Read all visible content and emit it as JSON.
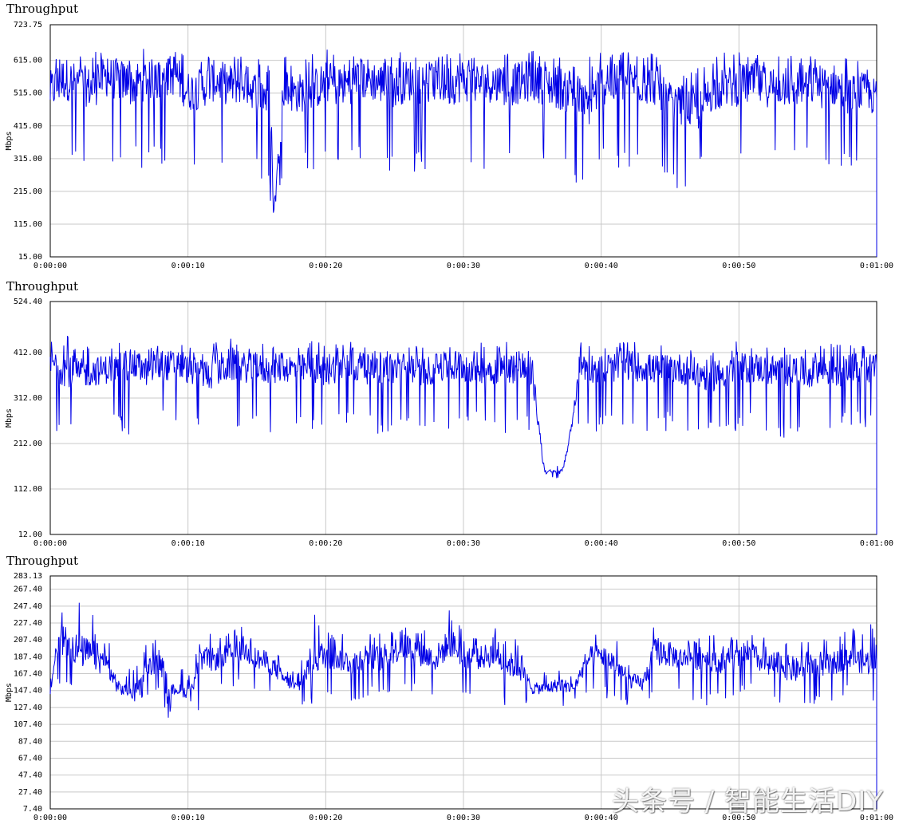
{
  "colors": {
    "series": "#0000e6",
    "grid": "#c8c8c8",
    "axis": "#000000"
  },
  "watermark": "头条号 / 智能生活DIY",
  "chart_data": [
    {
      "type": "line",
      "title": "Throughput",
      "ylabel": "Mbps",
      "ylim": [
        15.0,
        723.75
      ],
      "yticks": [
        "15.00",
        "115.00",
        "215.00",
        "315.00",
        "415.00",
        "515.00",
        "615.00",
        "723.75"
      ],
      "ytick_values": [
        15.0,
        115.0,
        215.0,
        315.0,
        415.0,
        515.0,
        615.0,
        723.75
      ],
      "xlim": [
        0,
        60
      ],
      "xticks": [
        "0:00:00",
        "0:00:10",
        "0:00:20",
        "0:00:30",
        "0:00:40",
        "0:00:50",
        "0:01:00"
      ],
      "grid": true,
      "series": [
        {
          "x": [
            0,
            1,
            2,
            3,
            4,
            5,
            6,
            7,
            8,
            9,
            10,
            11,
            12,
            13,
            14,
            15,
            16,
            16.2,
            17,
            18,
            19,
            20,
            21,
            22,
            23,
            24,
            25,
            26,
            27,
            28,
            29,
            30,
            31,
            32,
            33,
            34,
            35,
            36,
            37,
            38,
            39,
            40,
            41,
            42,
            43,
            44,
            45,
            46,
            47,
            48,
            49,
            50,
            51,
            52,
            53,
            54,
            55,
            56,
            57,
            58,
            59,
            60
          ],
          "y": [
            520,
            560,
            545,
            530,
            565,
            555,
            540,
            560,
            550,
            575,
            520,
            530,
            555,
            540,
            545,
            520,
            510,
            150,
            520,
            515,
            525,
            545,
            540,
            550,
            560,
            545,
            535,
            555,
            545,
            550,
            540,
            555,
            545,
            550,
            535,
            545,
            555,
            540,
            530,
            520,
            470,
            545,
            540,
            555,
            545,
            540,
            470,
            480,
            455,
            520,
            530,
            540,
            545,
            535,
            540,
            530,
            545,
            535,
            540,
            510,
            520,
            500
          ],
          "min_spikes": [
            280,
            270,
            290,
            275,
            285,
            260,
            270,
            275,
            290,
            280,
            270,
            265,
            280,
            275,
            285,
            280,
            150,
            150,
            285,
            270,
            280,
            275,
            265,
            270,
            275,
            280,
            270,
            275,
            265,
            280,
            275,
            270,
            285,
            280,
            270,
            275,
            280,
            275,
            240,
            205,
            265,
            275,
            270,
            280,
            275,
            270,
            230,
            220,
            270,
            280,
            275,
            270,
            280,
            275,
            270,
            280,
            275,
            240,
            270,
            275,
            280,
            270
          ],
          "max_peaks": [
            640,
            660,
            625,
            650,
            640,
            635,
            655,
            650,
            640,
            665,
            625,
            620,
            650,
            640,
            645,
            630,
            625,
            150,
            640,
            620,
            640,
            660,
            645,
            650,
            650,
            645,
            640,
            650,
            640,
            650,
            640,
            655,
            645,
            650,
            640,
            645,
            655,
            640,
            630,
            620,
            645,
            650,
            640,
            650,
            645,
            640,
            560,
            570,
            600,
            635,
            640,
            645,
            650,
            640,
            640,
            635,
            645,
            630,
            640,
            620,
            620,
            600
          ]
        }
      ]
    },
    {
      "type": "line",
      "title": "Throughput",
      "ylabel": "Mbps",
      "ylim": [
        12.0,
        524.4
      ],
      "yticks": [
        "12.00",
        "112.00",
        "212.00",
        "312.00",
        "412.00",
        "524.40"
      ],
      "ytick_values": [
        12.0,
        112.0,
        212.0,
        312.0,
        412.0,
        524.4
      ],
      "xlim": [
        0,
        60
      ],
      "xticks": [
        "0:00:00",
        "0:00:10",
        "0:00:20",
        "0:00:30",
        "0:00:40",
        "0:00:50",
        "0:01:00"
      ],
      "grid": true,
      "series": [
        {
          "x": [
            0,
            1,
            2,
            3,
            4,
            5,
            6,
            7,
            8,
            9,
            10,
            11,
            12,
            13,
            14,
            15,
            16,
            17,
            18,
            19,
            20,
            21,
            22,
            23,
            24,
            25,
            26,
            27,
            28,
            29,
            30,
            31,
            32,
            33,
            34,
            35,
            35.8,
            36,
            37,
            37.3,
            38,
            38.4,
            39,
            40,
            41,
            42,
            43,
            44,
            45,
            46,
            47,
            48,
            49,
            50,
            51,
            52,
            53,
            54,
            55,
            56,
            57,
            58,
            59,
            60
          ],
          "y": [
            390,
            380,
            365,
            370,
            375,
            380,
            385,
            370,
            380,
            385,
            375,
            365,
            370,
            385,
            380,
            375,
            375,
            380,
            375,
            380,
            370,
            385,
            380,
            375,
            380,
            375,
            380,
            370,
            375,
            380,
            385,
            380,
            375,
            380,
            375,
            370,
            160,
            150,
            148,
            160,
            275,
            390,
            380,
            375,
            380,
            385,
            380,
            375,
            380,
            375,
            365,
            360,
            370,
            375,
            380,
            375,
            370,
            375,
            365,
            375,
            370,
            375,
            380,
            375
          ],
          "min_spikes": [
            240,
            230,
            235,
            245,
            240,
            235,
            230,
            240,
            250,
            235,
            245,
            240,
            230,
            235,
            240,
            245,
            235,
            240,
            245,
            240,
            235,
            240,
            245,
            240,
            230,
            235,
            240,
            245,
            240,
            235,
            240,
            245,
            240,
            235,
            240,
            230,
            140,
            138,
            135,
            145,
            240,
            235,
            245,
            235,
            240,
            245,
            240,
            235,
            240,
            235,
            220,
            215,
            230,
            235,
            240,
            235,
            215,
            240,
            235,
            240,
            235,
            240,
            245,
            240
          ],
          "max_peaks": [
            440,
            470,
            425,
            430,
            425,
            435,
            430,
            420,
            430,
            440,
            425,
            420,
            460,
            445,
            430,
            440,
            425,
            430,
            425,
            440,
            430,
            445,
            440,
            430,
            440,
            435,
            430,
            425,
            430,
            440,
            470,
            440,
            430,
            440,
            425,
            420,
            175,
            170,
            165,
            175,
            290,
            445,
            430,
            425,
            430,
            440,
            430,
            425,
            440,
            430,
            420,
            415,
            425,
            440,
            430,
            425,
            430,
            435,
            425,
            440,
            430,
            435,
            440,
            430
          ]
        }
      ]
    },
    {
      "type": "line",
      "title": "Throughput",
      "ylabel": "Mbps",
      "ylim": [
        7.4,
        283.13
      ],
      "yticks": [
        "7.40",
        "27.40",
        "47.40",
        "67.40",
        "87.40",
        "107.40",
        "127.40",
        "147.40",
        "167.40",
        "187.40",
        "207.40",
        "227.40",
        "247.40",
        "267.40",
        "283.13"
      ],
      "ytick_values": [
        7.4,
        27.4,
        47.4,
        67.4,
        87.4,
        107.4,
        127.4,
        147.4,
        167.4,
        187.4,
        207.4,
        227.4,
        247.4,
        267.4,
        283.13
      ],
      "xlim": [
        0,
        60
      ],
      "xticks": [
        "0:00:00",
        "0:00:10",
        "0:00:20",
        "0:00:30",
        "0:00:40",
        "0:00:50",
        "0:01:00"
      ],
      "grid": true,
      "series": [
        {
          "x": [
            0,
            0.5,
            1,
            2,
            3,
            4,
            5,
            6,
            7,
            8,
            8.5,
            9,
            10,
            11,
            12,
            13,
            14,
            15,
            16,
            17,
            18,
            19,
            20,
            21,
            22,
            23,
            24,
            25,
            26,
            27,
            28,
            29,
            30,
            31,
            32,
            33,
            34,
            35,
            36,
            37,
            38,
            39,
            40,
            41,
            42,
            43,
            44,
            45,
            46,
            47,
            48,
            49,
            50,
            51,
            52,
            53,
            54,
            55,
            56,
            57,
            58,
            59,
            60
          ],
          "y": [
            150,
            200,
            210,
            195,
            190,
            180,
            150,
            145,
            175,
            180,
            140,
            150,
            145,
            180,
            185,
            190,
            195,
            185,
            180,
            160,
            150,
            185,
            190,
            185,
            180,
            190,
            185,
            195,
            200,
            190,
            185,
            205,
            190,
            185,
            190,
            180,
            175,
            150,
            150,
            155,
            150,
            185,
            190,
            180,
            160,
            155,
            195,
            190,
            185,
            190,
            185,
            180,
            185,
            190,
            175,
            180,
            170,
            180,
            175,
            180,
            190,
            180,
            185
          ],
          "min_spikes": [
            115,
            150,
            155,
            140,
            135,
            120,
            130,
            130,
            140,
            150,
            110,
            135,
            130,
            120,
            140,
            145,
            150,
            140,
            135,
            130,
            130,
            130,
            135,
            140,
            130,
            140,
            135,
            140,
            145,
            140,
            130,
            145,
            130,
            140,
            135,
            130,
            125,
            130,
            130,
            125,
            135,
            130,
            140,
            135,
            125,
            125,
            150,
            140,
            140,
            120,
            135,
            130,
            140,
            145,
            130,
            120,
            115,
            130,
            130,
            135,
            140,
            135,
            130
          ],
          "max_peaks": [
            190,
            250,
            265,
            255,
            240,
            225,
            175,
            175,
            205,
            210,
            165,
            175,
            175,
            210,
            220,
            215,
            225,
            215,
            210,
            175,
            170,
            240,
            230,
            220,
            215,
            225,
            220,
            230,
            235,
            225,
            220,
            245,
            225,
            215,
            225,
            215,
            210,
            170,
            170,
            175,
            170,
            210,
            220,
            215,
            180,
            175,
            255,
            225,
            215,
            225,
            215,
            210,
            215,
            225,
            210,
            215,
            200,
            215,
            210,
            215,
            225,
            215,
            240
          ]
        }
      ]
    }
  ]
}
